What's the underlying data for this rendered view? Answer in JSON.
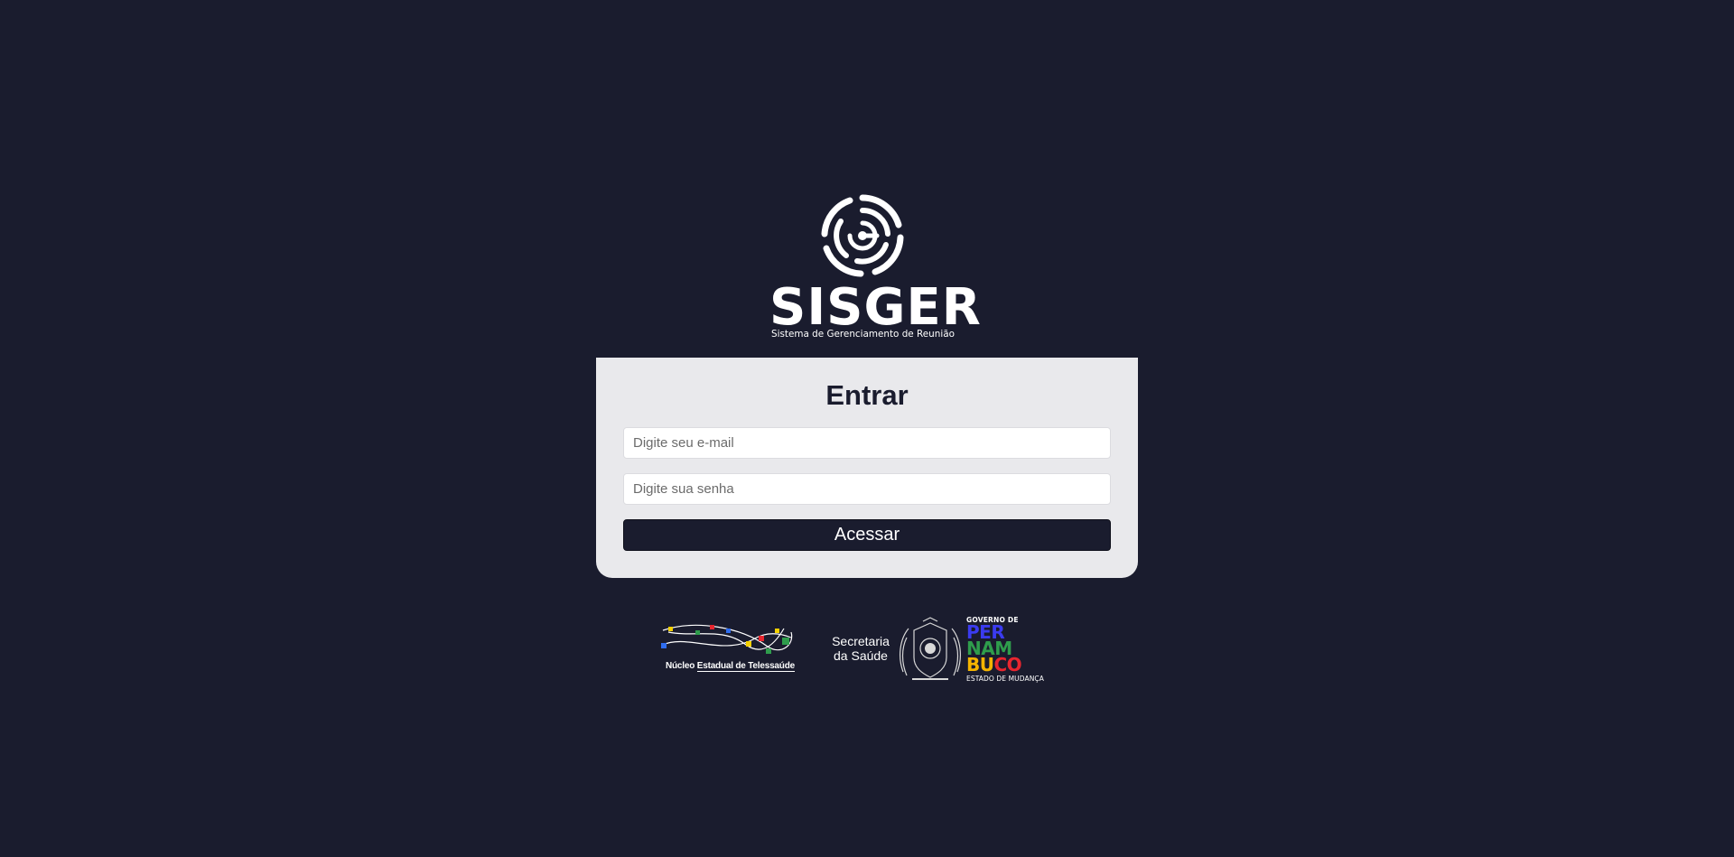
{
  "app": {
    "name": "SISGER",
    "subtitle": "Sistema de Gerenciamento de Reunião"
  },
  "login": {
    "title": "Entrar",
    "email_placeholder": "Digite seu e-mail",
    "password_placeholder": "Digite sua senha",
    "submit_label": "Acessar"
  },
  "footer": {
    "nucleo": {
      "line_a": "Núcleo",
      "line_b": "Estadual de Telessaúde"
    },
    "secretaria": {
      "line1": "Secretaria",
      "line2": "da Saúde"
    },
    "governo": {
      "top": "GOVERNO DE",
      "line1": "PER",
      "line2": "NAM",
      "line3a": "BU",
      "line3b": "CO",
      "bottom": "ESTADO DE MUDANÇA"
    }
  },
  "colors": {
    "background": "#1a1c2e",
    "card": "#e9e9ec",
    "button": "#1a1c2e",
    "text_light": "#ffffff"
  },
  "icons": {
    "logo": "sisger-logo-icon",
    "nucleo_logo": "telessaude-network-icon",
    "seal": "pernambuco-seal-icon"
  }
}
